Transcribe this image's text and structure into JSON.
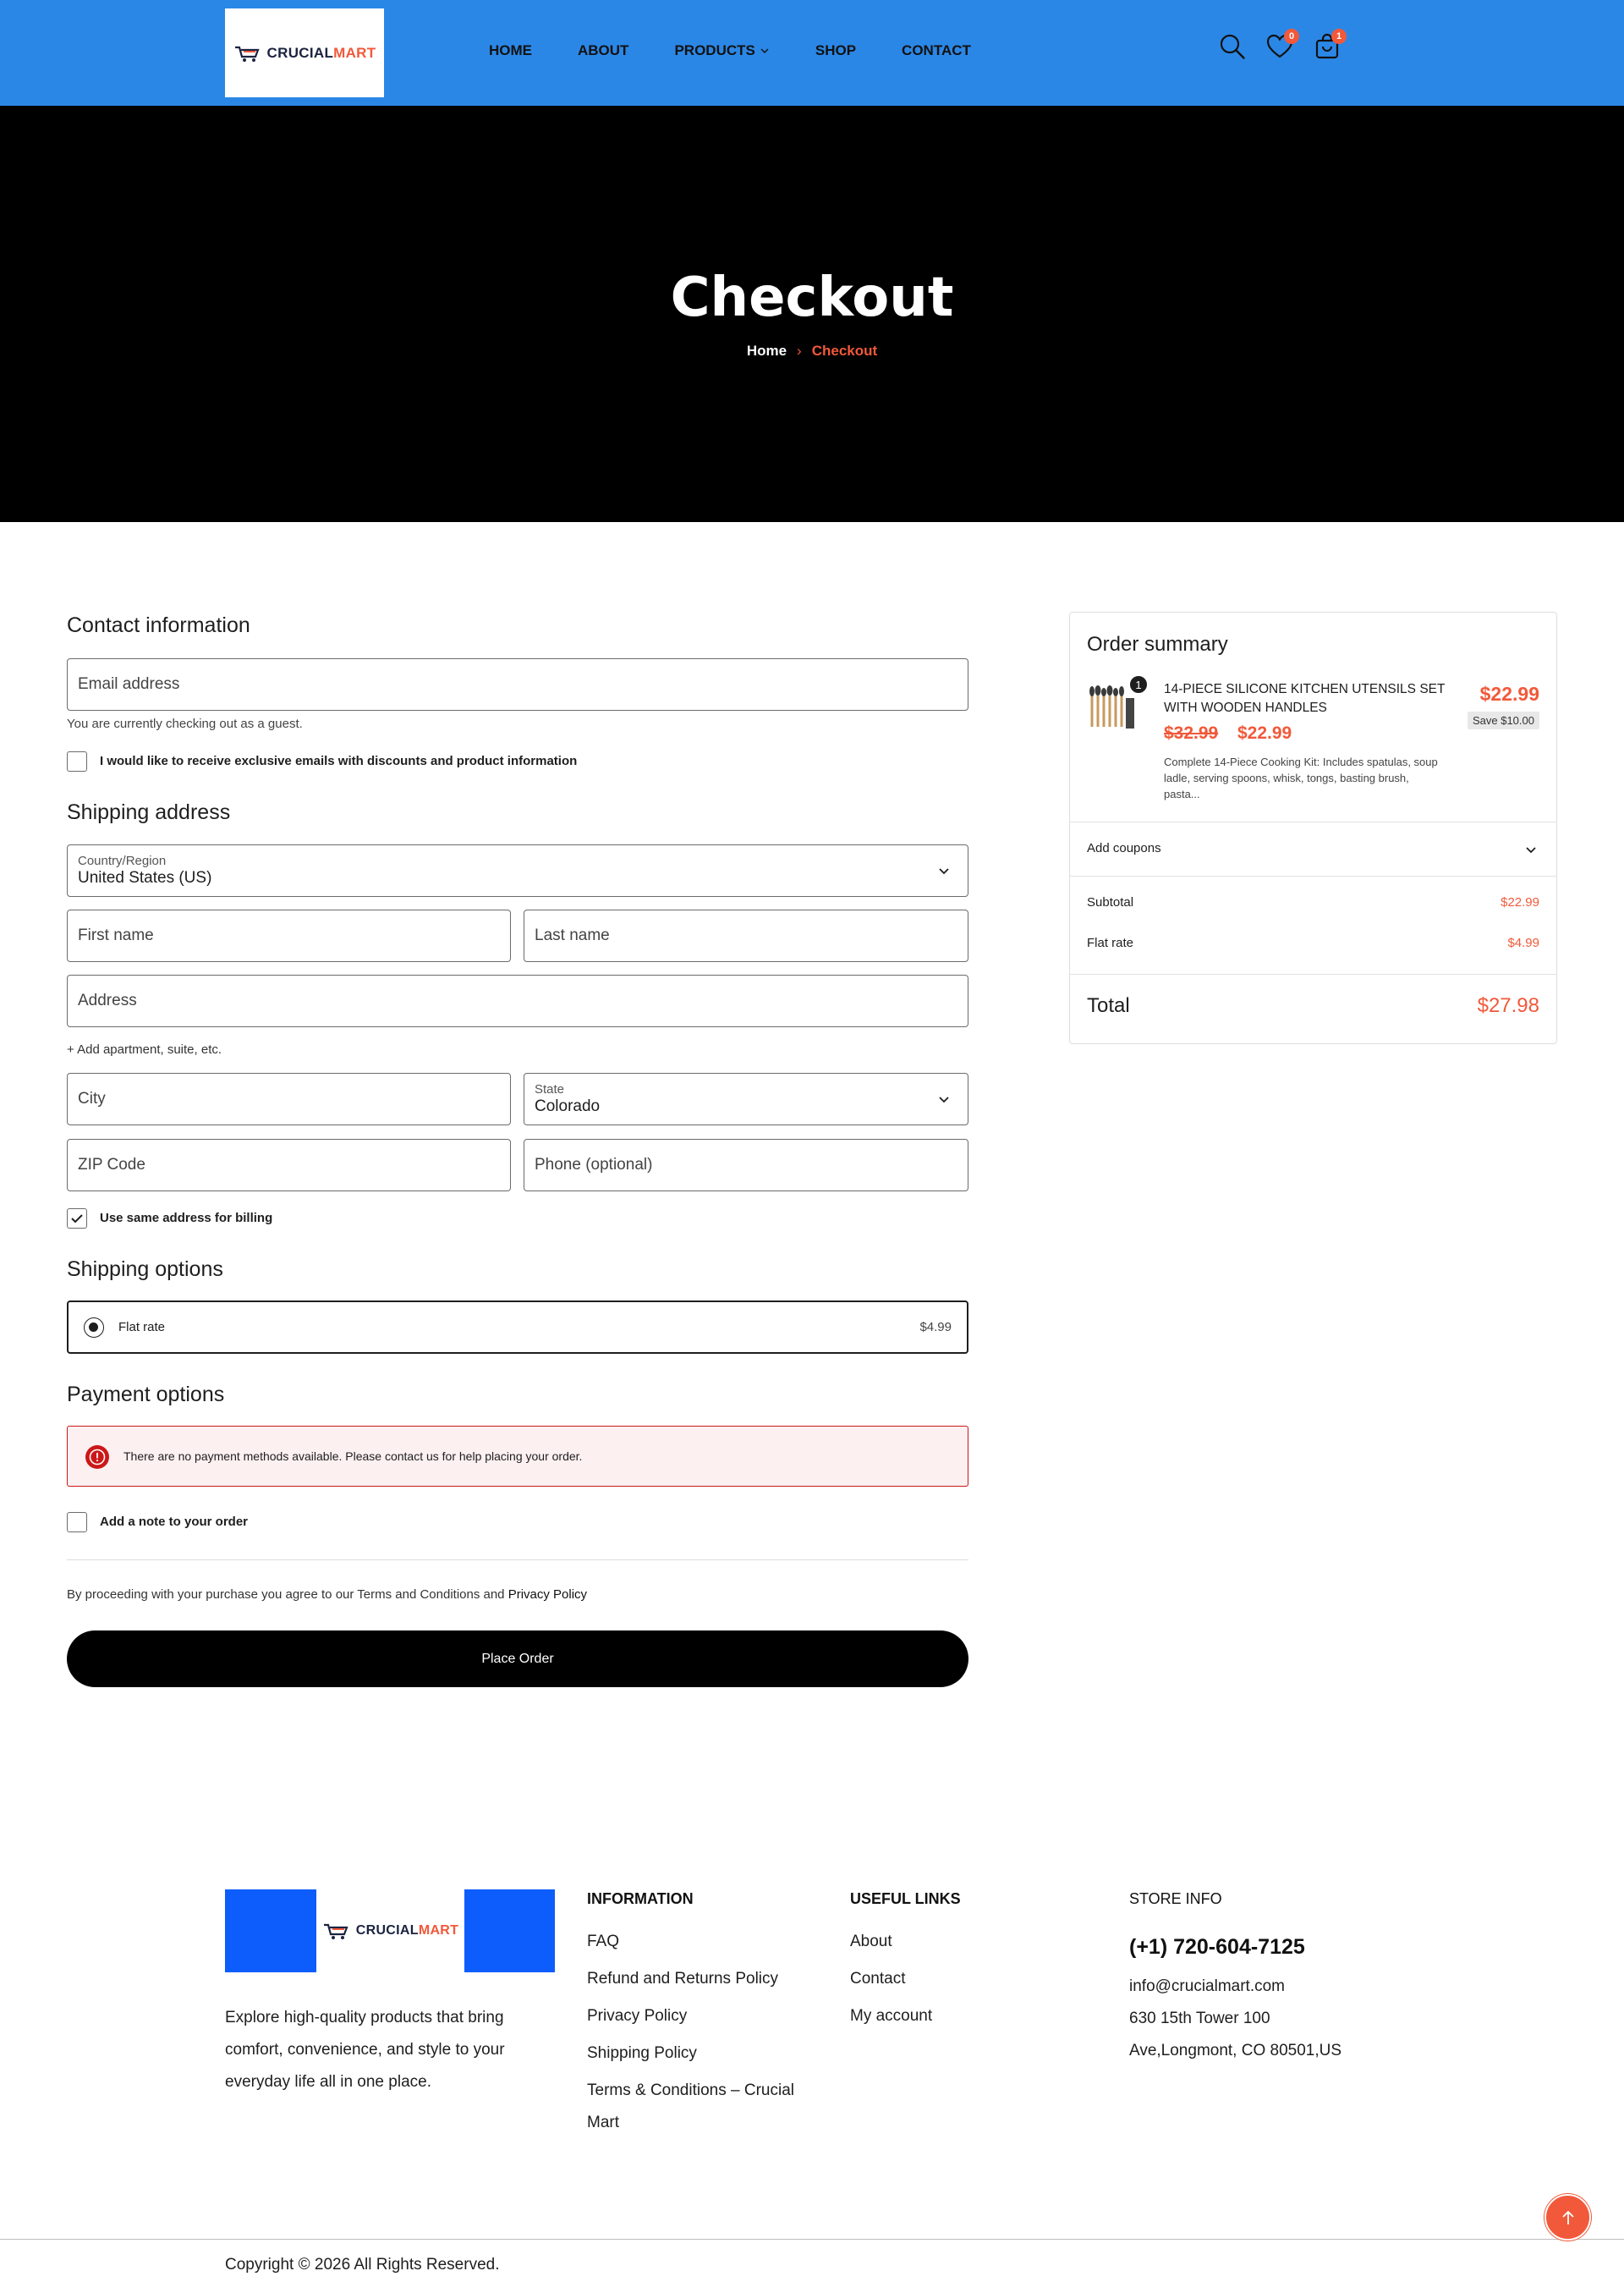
{
  "header": {
    "logo": {
      "part1": "CRUCIAL",
      "part2": "MART"
    },
    "nav": [
      {
        "label": "HOME"
      },
      {
        "label": "ABOUT"
      },
      {
        "label": "PRODUCTS"
      },
      {
        "label": "SHOP"
      },
      {
        "label": "CONTACT"
      }
    ],
    "wishlist_count": "0",
    "cart_count": "1"
  },
  "hero": {
    "title": "Checkout",
    "breadcrumb": {
      "home": "Home",
      "separator": "›",
      "current": "Checkout"
    }
  },
  "contact": {
    "title": "Contact information",
    "email_placeholder": "Email address",
    "guest_note": "You are currently checking out as a guest.",
    "newsletter_label": "I would like to receive exclusive emails with discounts and product information",
    "newsletter_checked": false
  },
  "shipping_address": {
    "title": "Shipping address",
    "country_label": "Country/Region",
    "country_value": "United States (US)",
    "first_name_placeholder": "First name",
    "last_name_placeholder": "Last name",
    "address_placeholder": "Address",
    "add_apartment": "+ Add apartment, suite, etc.",
    "city_placeholder": "City",
    "state_label": "State",
    "state_value": "Colorado",
    "zip_placeholder": "ZIP Code",
    "phone_placeholder": "Phone (optional)",
    "billing_same_label": "Use same address for billing",
    "billing_same_checked": true
  },
  "shipping_options": {
    "title": "Shipping options",
    "option_label": "Flat rate",
    "option_price": "$4.99",
    "selected": true
  },
  "payment": {
    "title": "Payment options",
    "alert": "There are no payment methods available. Please contact us for help placing your order.",
    "note_label": "Add a note to your order",
    "note_checked": false
  },
  "terms": {
    "prefix": "By proceeding with your purchase you agree to our Terms and Conditions and ",
    "privacy": "Privacy Policy"
  },
  "place_order": "Place Order",
  "summary": {
    "title": "Order summary",
    "item": {
      "quantity": "1",
      "name": "14-PIECE SILICONE KITCHEN UTENSILS SET WITH WOODEN HANDLES",
      "old_price": "$32.99",
      "new_price": "$22.99",
      "description": "Complete 14-Piece Cooking Kit: Includes spatulas, soup ladle, serving spoons, whisk, tongs, basting brush, pasta...",
      "line_total": "$22.99",
      "save": "Save $10.00"
    },
    "coupons": "Add coupons",
    "subtotal_label": "Subtotal",
    "subtotal_value": "$22.99",
    "shipping_label": "Flat rate",
    "shipping_value": "$4.99",
    "total_label": "Total",
    "total_value": "$27.98"
  },
  "footer": {
    "description": "Explore high-quality products that bring comfort, convenience, and style to your everyday life all in one place.",
    "info_title": "INFORMATION",
    "info_links": [
      "FAQ",
      "Refund and Returns Policy",
      "Privacy Policy",
      "Shipping Policy",
      "Terms & Conditions – Crucial Mart"
    ],
    "useful_title": "USEFUL LINKS",
    "useful_links": [
      "About",
      "Contact",
      "My account"
    ],
    "store_title": "STORE INFO",
    "phone": "(+1) 720-604-7125",
    "email": "info@crucialmart.com",
    "address_line1": "630 15th Tower 100",
    "address_line2": "Ave,Longmont, CO 80501,US",
    "copyright": "Copyright © 2026 All Rights Reserved."
  },
  "colors": {
    "header_bg": "#2b87e6",
    "accent": "#f1593a",
    "hero_bg": "#000000",
    "footer_logo_bg": "#0d5dfc"
  },
  "icons": [
    "cart-logo-icon",
    "chevron-down-icon",
    "search-icon",
    "heart-icon",
    "bag-icon",
    "check-icon",
    "alert-icon",
    "arrow-up-icon"
  ]
}
